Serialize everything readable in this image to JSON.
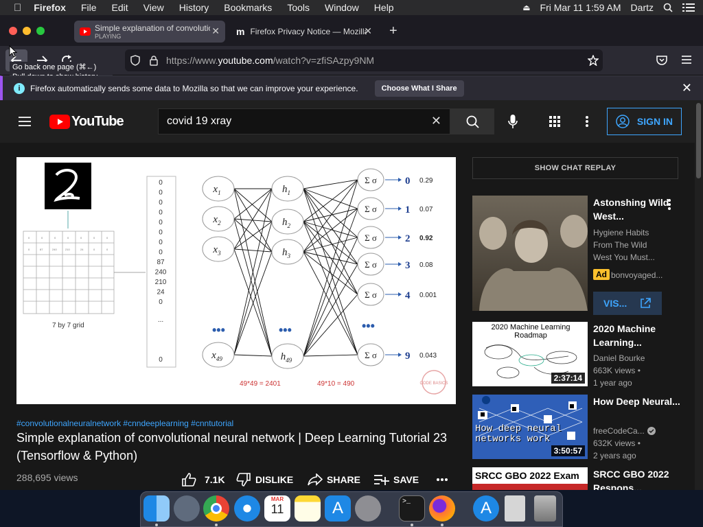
{
  "menubar": {
    "app": "Firefox",
    "items": [
      "File",
      "Edit",
      "View",
      "History",
      "Bookmarks",
      "Tools",
      "Window",
      "Help"
    ],
    "clock": "Fri Mar 11  1:59 AM",
    "user": "Dartz"
  },
  "tabs": [
    {
      "title": "Simple explanation of convolutio",
      "subtitle": "PLAYING",
      "icon": "youtube-icon"
    },
    {
      "title": "Firefox Privacy Notice — Mozilla",
      "icon": "mozilla-icon"
    }
  ],
  "nav": {
    "url_prefix": "https://www.",
    "url_domain": "youtube.com",
    "url_rest": "/watch?v=zfiSAzpy9NM",
    "tooltip_line1": "Go back one page (⌘←)",
    "tooltip_line2": "Pull down to show history"
  },
  "notification": {
    "text": "Firefox automatically sends some data to Mozilla so that we can improve your experience.",
    "button": "Choose What I Share"
  },
  "youtube": {
    "logo": "YouTube",
    "search_value": "covid 19 xray",
    "sign_in": "SIGN IN"
  },
  "video": {
    "hashtags": "#convolutionalneuralnetwork #cnndeeplearning #cnntutorial",
    "title": "Simple explanation of convolutional neural network | Deep Learning Tutorial 23 (Tensorflow & Python)",
    "views": "288,695 views",
    "likes": "7.1K",
    "dislike": "DISLIKE",
    "share": "SHARE",
    "save": "SAVE",
    "frame": {
      "grid_caption": "7 by 7 grid",
      "column_values": [
        "0",
        "0",
        "0",
        "0",
        "0",
        "0",
        "0",
        "0",
        "87",
        "240",
        "210",
        "24",
        "0",
        "...",
        "0"
      ],
      "inputs": [
        "x1",
        "x2",
        "x3",
        "x49"
      ],
      "hidden": [
        "h1",
        "h2",
        "h3",
        "h49"
      ],
      "outputs": [
        "0",
        "1",
        "2",
        "3",
        "4",
        "9"
      ],
      "probs": [
        "0.29",
        "0.07",
        "0.92",
        "0.08",
        "0.001",
        "0.043"
      ],
      "calc1": "49*49 = 2401",
      "calc2": "49*10 = 490",
      "badge": "CODE BASICS"
    }
  },
  "sidebar": {
    "chat_replay": "SHOW CHAT REPLAY",
    "items": [
      {
        "title": "Astonshing Wild West...",
        "desc": "Hygiene Habits From The Wild West You Must...",
        "ad": "Ad",
        "channel": "bonvoyaged...",
        "cta": "VIS..."
      },
      {
        "title": "2020 Machine Learning...",
        "channel": "Daniel Bourke",
        "views": "663K views •",
        "age": "1 year ago",
        "duration": "2:37:14",
        "thumb_title": "2020 Machine Learning Roadmap"
      },
      {
        "title": "How Deep Neural...",
        "channel": "freeCodeCa...",
        "views": "632K views •",
        "age": "2 years ago",
        "duration": "3:50:57",
        "thumb_text": "How deep neural networks work"
      },
      {
        "title": "SRCC GBO 2022 Respons...",
        "thumb_text": "SRCC GBO 2022 Exam"
      }
    ]
  },
  "dock": {
    "calendar_month": "MAR",
    "calendar_day": "11"
  }
}
